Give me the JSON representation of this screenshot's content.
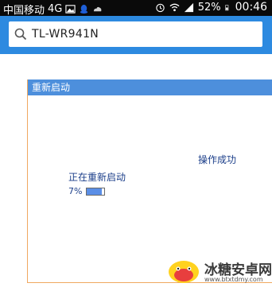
{
  "status_bar": {
    "carrier": "中国移动",
    "network": "4G",
    "battery_pct": "52%",
    "time": "00:46"
  },
  "search": {
    "query": "TL-WR941N"
  },
  "dialog": {
    "title": "重新启动",
    "success_message": "操作成功",
    "restart_status": "正在重新启动",
    "progress_label": "7%",
    "progress_value": 0.07
  },
  "watermark": {
    "name": "冰糖安卓网",
    "url": "www.btxtdmy.com"
  },
  "colors": {
    "accent": "#2d8ae0",
    "dialog_title_bg": "#4d8fdc",
    "dialog_border": "#f0a860",
    "progress_fill": "#5a8ee6",
    "status_text": "#1c3f8a"
  }
}
